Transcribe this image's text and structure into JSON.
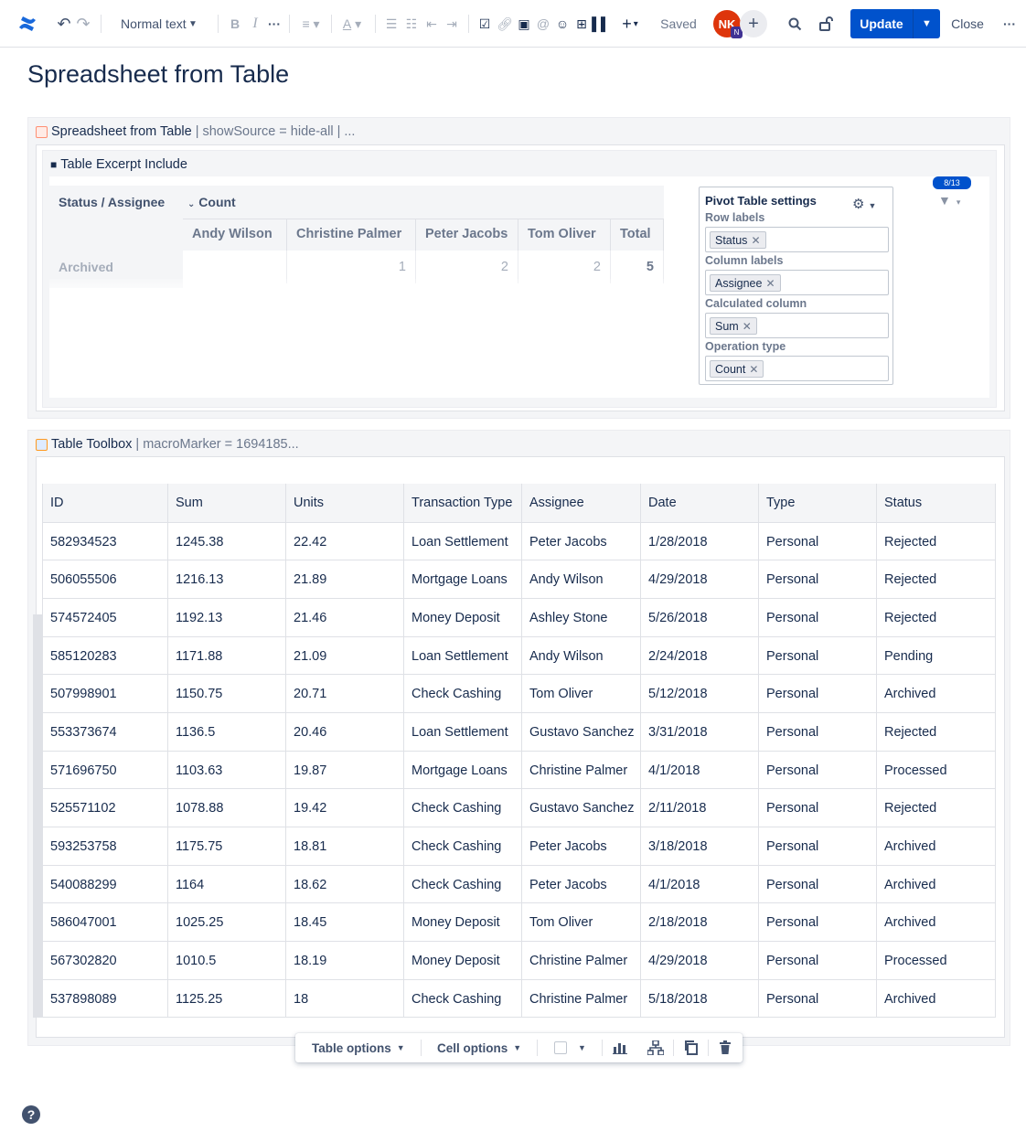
{
  "toolbar": {
    "text_style": "Normal text",
    "saved": "Saved",
    "avatar_initials": "NK",
    "avatar_badge": "N",
    "update": "Update",
    "close": "Close"
  },
  "page": {
    "title": "Spreadsheet from Table"
  },
  "spreadsheet_macro": {
    "name": "Spreadsheet from Table",
    "params": "| showSource = hide-all | ..."
  },
  "excerpt_macro": {
    "name": "Table Excerpt Include"
  },
  "pivot": {
    "corner": "Status / Assignee",
    "count_label": "Count",
    "columns": [
      "Andy Wilson",
      "Christine Palmer",
      "Peter Jacobs",
      "Tom Oliver",
      "Total"
    ],
    "rows": [
      {
        "label": "Archived",
        "values": [
          "",
          "1",
          "2",
          "2",
          "5"
        ]
      }
    ]
  },
  "pivot_settings": {
    "title": "Pivot Table settings",
    "row_labels": "Row labels",
    "row_chip": "Status",
    "column_labels": "Column labels",
    "column_chip": "Assignee",
    "calculated_column": "Calculated column",
    "calc_chip": "Sum",
    "operation_type": "Operation type",
    "op_chip": "Count"
  },
  "filter_badge": "8/13",
  "toolbox_macro": {
    "name": "Table Toolbox",
    "params": "| macroMarker = 1694185..."
  },
  "table": {
    "headers": [
      "ID",
      "Sum",
      "Units",
      "Transaction Type",
      "Assignee",
      "Date",
      "Type",
      "Status"
    ],
    "rows": [
      [
        "582934523",
        "1245.38",
        "22.42",
        "Loan Settlement",
        "Peter Jacobs",
        "1/28/2018",
        "Personal",
        "Rejected"
      ],
      [
        "506055506",
        "1216.13",
        "21.89",
        "Mortgage Loans",
        "Andy Wilson",
        "4/29/2018",
        "Personal",
        "Rejected"
      ],
      [
        "574572405",
        "1192.13",
        "21.46",
        "Money Deposit",
        "Ashley Stone",
        "5/26/2018",
        "Personal",
        "Rejected"
      ],
      [
        "585120283",
        "1171.88",
        "21.09",
        "Loan Settlement",
        "Andy Wilson",
        "2/24/2018",
        "Personal",
        "Pending"
      ],
      [
        "507998901",
        "1150.75",
        "20.71",
        "Check Cashing",
        "Tom Oliver",
        "5/12/2018",
        "Personal",
        "Archived"
      ],
      [
        "553373674",
        "1136.5",
        "20.46",
        "Loan Settlement",
        "Gustavo Sanchez",
        "3/31/2018",
        "Personal",
        "Rejected"
      ],
      [
        "571696750",
        "1103.63",
        "19.87",
        "Mortgage Loans",
        "Christine Palmer",
        "4/1/2018",
        "Personal",
        "Processed"
      ],
      [
        "525571102",
        "1078.88",
        "19.42",
        "Check Cashing",
        "Gustavo Sanchez",
        "2/11/2018",
        "Personal",
        "Rejected"
      ],
      [
        "593253758",
        "1175.75",
        "18.81",
        "Check Cashing",
        "Peter Jacobs",
        "3/18/2018",
        "Personal",
        "Archived"
      ],
      [
        "540088299",
        "1164",
        "18.62",
        "Check Cashing",
        "Peter Jacobs",
        "4/1/2018",
        "Personal",
        "Archived"
      ],
      [
        "586047001",
        "1025.25",
        "18.45",
        "Money Deposit",
        "Tom Oliver",
        "2/18/2018",
        "Personal",
        "Archived"
      ],
      [
        "567302820",
        "1010.5",
        "18.19",
        "Money Deposit",
        "Christine Palmer",
        "4/29/2018",
        "Personal",
        "Processed"
      ],
      [
        "537898089",
        "1125.25",
        "18",
        "Check Cashing",
        "Christine Palmer",
        "5/18/2018",
        "Personal",
        "Archived"
      ]
    ]
  },
  "table_bar": {
    "table_options": "Table options",
    "cell_options": "Cell options"
  },
  "colors": {
    "primary": "#0052cc",
    "avatar": "#de350b",
    "header_bg": "#f4f5f7"
  }
}
